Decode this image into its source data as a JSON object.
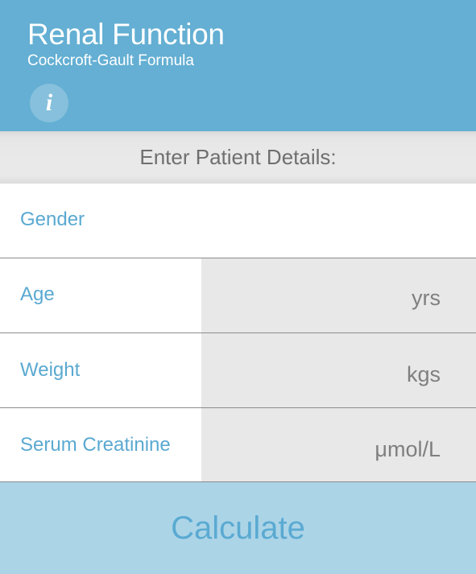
{
  "header": {
    "title": "Renal Function",
    "subtitle": "Cockcroft-Gault Formula",
    "info_icon": "i"
  },
  "section": {
    "title": "Enter Patient Details:"
  },
  "fields": [
    {
      "label": "Gender",
      "unit": "",
      "value": ""
    },
    {
      "label": "Age",
      "unit": "yrs",
      "value": ""
    },
    {
      "label": "Weight",
      "unit": "kgs",
      "value": ""
    },
    {
      "label": "Serum Creatinine",
      "unit": "μmol/L",
      "value": ""
    }
  ],
  "actions": {
    "calculate_label": "Calculate"
  },
  "colors": {
    "header_bg": "#64afd3",
    "label_text": "#5aa9d1",
    "input_bg": "#e8e8e8",
    "button_bg": "#acd4e7",
    "button_text": "#5aaad2"
  },
  "icons": {
    "info": "info-icon"
  }
}
